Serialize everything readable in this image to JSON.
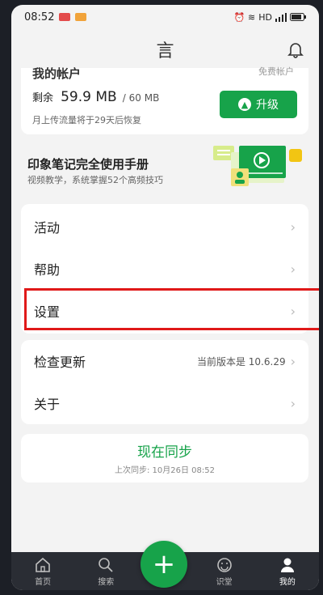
{
  "status": {
    "time": "08:52",
    "network": "HD",
    "right_glyphs": "⏰ ≋ "
  },
  "header": {
    "title": "言"
  },
  "account": {
    "title": "我的帐户",
    "link": "免费帐户",
    "storage_label": "剩余",
    "used": "59.9 MB",
    "total": "/ 60 MB",
    "reset_note": "月上传流量将于29天后恢复",
    "upgrade_label": "升级",
    "upgrade_icon": "up-arrow-icon"
  },
  "banner": {
    "title": "印象笔记完全使用手册",
    "subtitle": "视频教学，系统掌握52个高频技巧"
  },
  "menu": [
    {
      "label": "活动"
    },
    {
      "label": "帮助"
    },
    {
      "label": "设置"
    }
  ],
  "update": {
    "label": "检查更新",
    "version": "当前版本是 10.6.29"
  },
  "about": {
    "label": "关于"
  },
  "sync": {
    "button": "现在同步",
    "last_sync": "上次同步: 10月26日 08:52"
  },
  "nav": [
    {
      "label": "首页",
      "icon": "home-icon"
    },
    {
      "label": "搜索",
      "icon": "search-icon"
    },
    {
      "label": "识堂",
      "icon": "smile-icon"
    },
    {
      "label": "我的",
      "icon": "user-icon"
    }
  ],
  "fab": {
    "label": "+"
  },
  "colors": {
    "accent": "#17a34a",
    "highlight": "#e01919",
    "nav_bg": "#2a2d34"
  }
}
